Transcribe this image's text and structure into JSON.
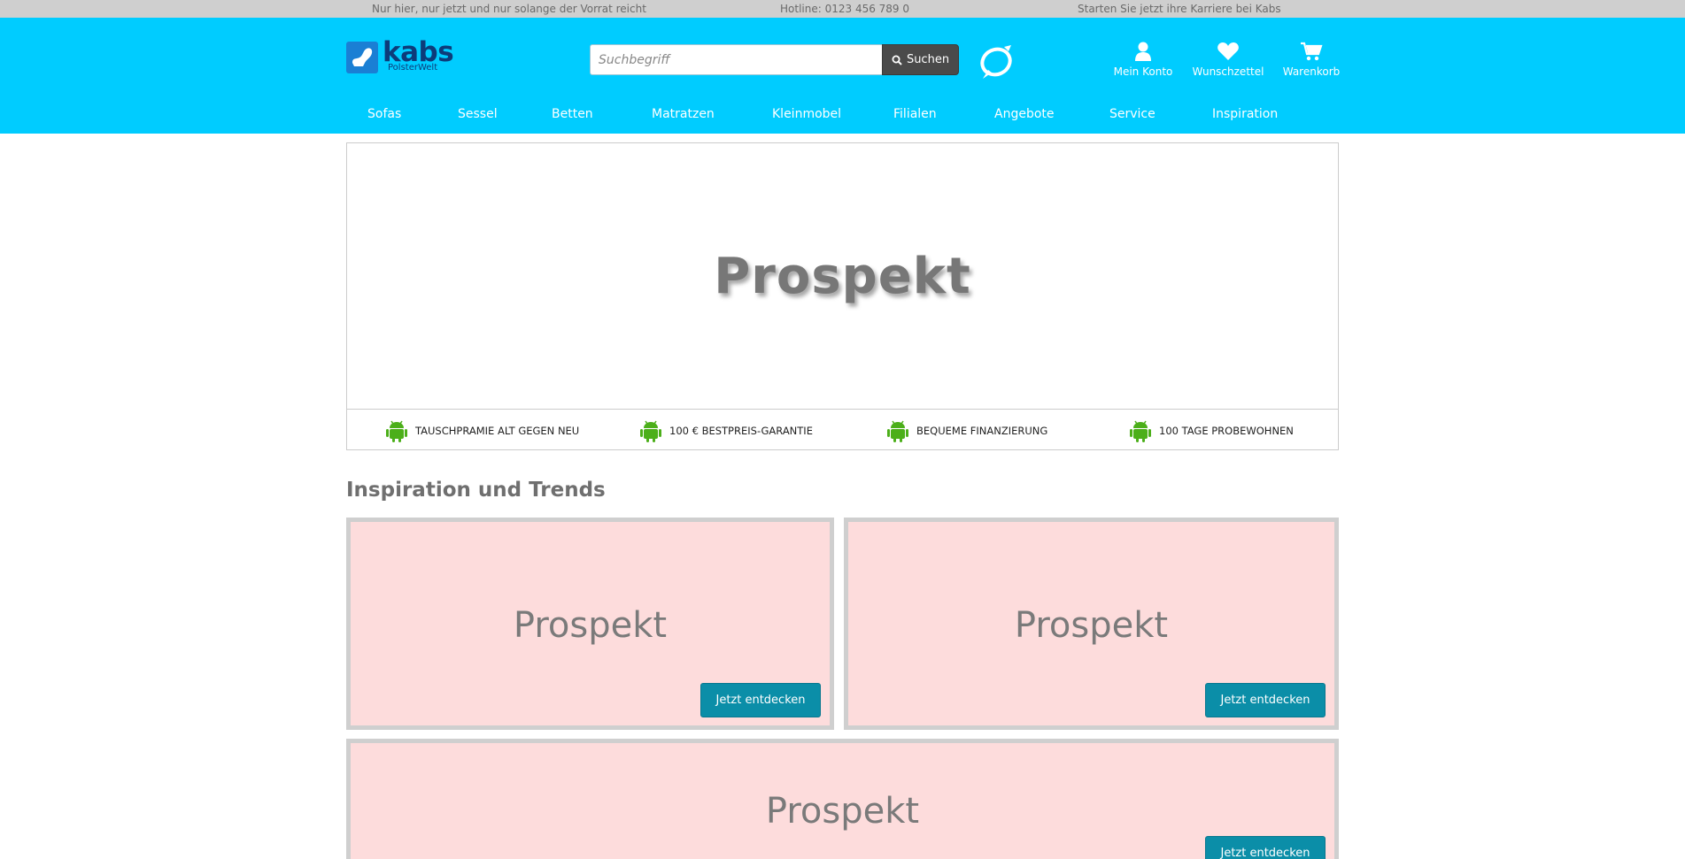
{
  "topbar": {
    "promo": "Nur hier, nur jetzt und nur solange der Vorrat reicht",
    "hotline": "Hotline: 0123 456 789 0",
    "career": "Starten Sie jetzt ihre Karriere bei Kabs"
  },
  "header": {
    "logo_name": "kabs",
    "logo_sub": "PolsterWelt",
    "search_placeholder": "Suchbegriff",
    "search_button": "Suchen",
    "links": {
      "account": "Mein Konto",
      "wishlist": "Wunschzettel",
      "cart": "Warenkorb"
    },
    "icons": {
      "search": "search-icon",
      "account": "user-icon",
      "wishlist": "heart-icon",
      "cart": "cart-icon",
      "brand": "brand-swirl-icon"
    }
  },
  "nav": [
    "Sofas",
    "Sessel",
    "Betten",
    "Matratzen",
    "Kleinmobel",
    "Filialen",
    "Angebote",
    "Service",
    "Inspiration"
  ],
  "hero": {
    "title": "Prospekt",
    "features": [
      "TAUSCHPRAMIE ALT GEGEN NEU",
      "100 € BESTPREIS-GARANTIE",
      "BEQUEME FINANZIERUNG",
      "100 TAGE PROBEWOHNEN"
    ],
    "feature_icon": "android-icon"
  },
  "inspiration": {
    "title": "Inspiration und Trends",
    "tiles": [
      {
        "title": "Prospekt",
        "button": "Jetzt entdecken"
      },
      {
        "title": "Prospekt",
        "button": "Jetzt entdecken"
      },
      {
        "title": "Prospekt",
        "button": "Jetzt entdecken"
      }
    ]
  },
  "colors": {
    "header_bg": "#00ccff",
    "topbar_bg": "#cfcfcf",
    "tile_bg": "#fddcdc",
    "button_bg": "#0b8ea8",
    "logo_blue": "#0d3c7a",
    "android_green": "#4caf1a"
  }
}
